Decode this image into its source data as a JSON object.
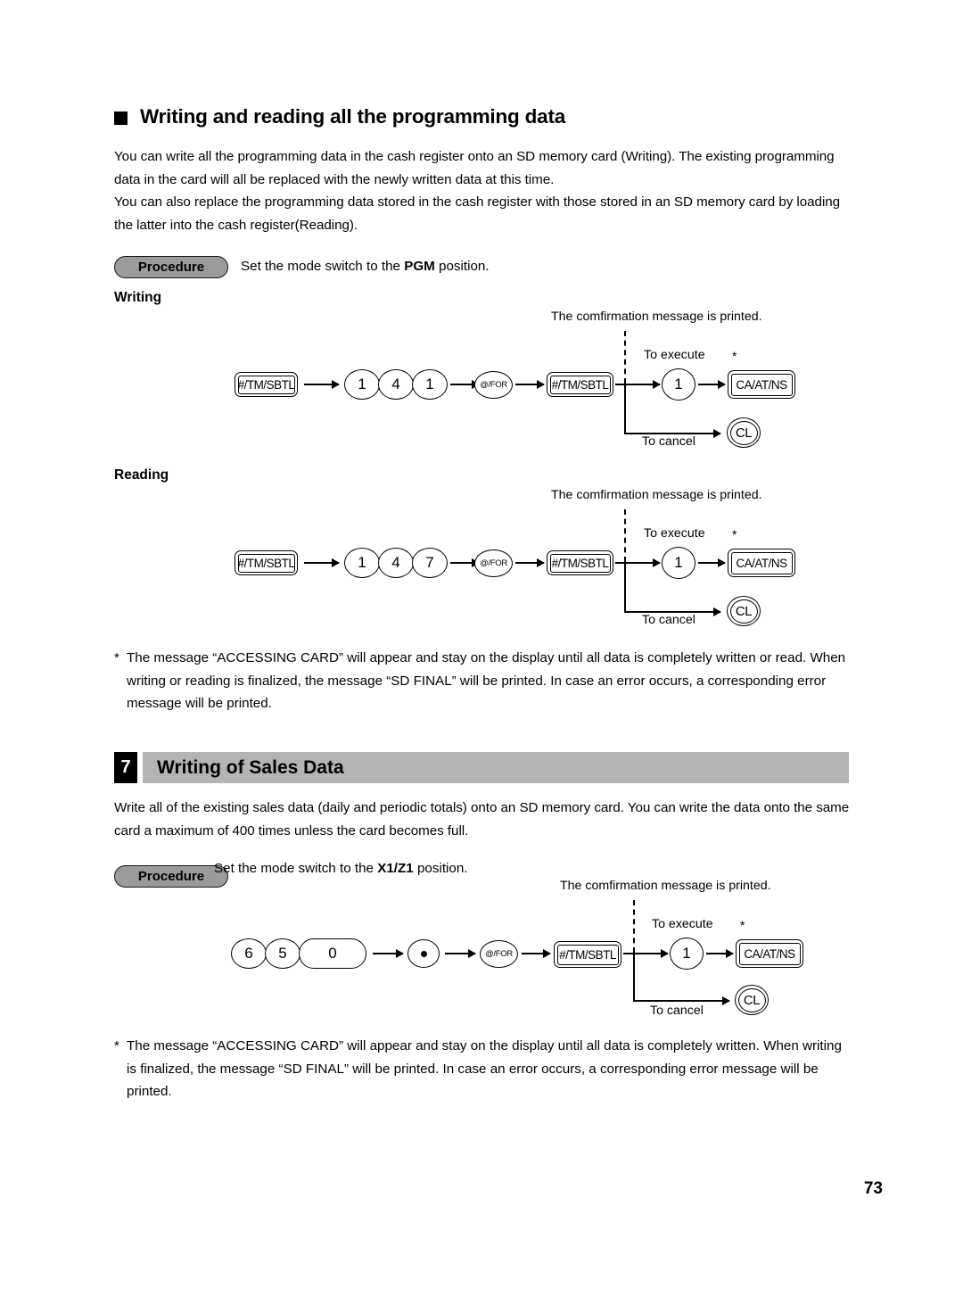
{
  "document": {
    "page_number": "73"
  },
  "section_writing_reading": {
    "heading": "Writing and reading all the programming data",
    "bullet_icon": "black-square-bullet",
    "paragraph_1": "You can write all the programming data in the cash register onto an SD memory card (Writing). The existing programming data in the card will all be replaced with the newly written data at this time.",
    "paragraph_2": "You can also replace the programming data stored in the cash register with those stored in an SD memory card by loading the latter into the cash register(Reading).",
    "procedure": {
      "badge_label": "Procedure",
      "instruction_prefix": "Set the mode switch to the ",
      "instruction_mode": "PGM",
      "instruction_suffix": " position."
    },
    "writing_label": "Writing",
    "reading_label": "Reading",
    "footnote_star": "*",
    "footnote": "The message “ACCESSING CARD” will appear and stay on the display until all data is completely written or read. When writing or reading is finalized, the message “SD FINAL” will be printed. In case an error occurs, a corresponding error message will be printed."
  },
  "section_sales_data": {
    "number": "7",
    "heading": "Writing of Sales Data",
    "paragraph": "Write all of the existing sales data (daily and periodic totals) onto an SD memory card. You can write the data onto the same card a maximum of 400 times unless the card becomes full.",
    "procedure": {
      "badge_label": "Procedure",
      "instruction_prefix": "Set the mode switch to the ",
      "instruction_mode": "X1/Z1",
      "instruction_suffix": " position."
    },
    "footnote_star": "*",
    "footnote": "The message “ACCESSING CARD” will appear and stay on the display until all data is completely written. When writing is finalized, the message “SD FINAL” will be printed. In case an error occurs, a corresponding error message will be printed."
  },
  "diagram_writing": {
    "keys": {
      "k1": "#/TM/SBTL",
      "k2": "1",
      "k3": "4",
      "k4": "1",
      "k5": "@/FOR",
      "k6": "#/TM/SBTL",
      "k7": "1",
      "k8": "CA/AT/NS",
      "k9": "CL"
    },
    "captions": {
      "confirmation": "The comfirmation message is printed.",
      "to_execute": "To execute",
      "to_cancel": "To cancel",
      "star": "*"
    }
  },
  "diagram_reading": {
    "keys": {
      "k1": "#/TM/SBTL",
      "k2": "1",
      "k3": "4",
      "k4": "7",
      "k5": "@/FOR",
      "k6": "#/TM/SBTL",
      "k7": "1",
      "k8": "CA/AT/NS",
      "k9": "CL"
    },
    "captions": {
      "confirmation": "The comfirmation message is printed.",
      "to_execute": "To execute",
      "to_cancel": "To cancel",
      "star": "*"
    }
  },
  "diagram_sales": {
    "keys": {
      "k1": "6",
      "k2": "5",
      "k3": "0",
      "k4": "decimal-point-key",
      "k5": "@/FOR",
      "k6": "#/TM/SBTL",
      "k7": "1",
      "k8": "CA/AT/NS",
      "k9": "CL"
    },
    "captions": {
      "confirmation": "The comfirmation message is printed.",
      "to_execute": "To execute",
      "to_cancel": "To cancel",
      "star": "*"
    }
  },
  "colors": {
    "procedure_pill_fill": "#9b9b9b",
    "section_bar_fill": "#b4b4b4",
    "section_number_fill": "#000000",
    "text": "#000000",
    "background": "#ffffff"
  }
}
